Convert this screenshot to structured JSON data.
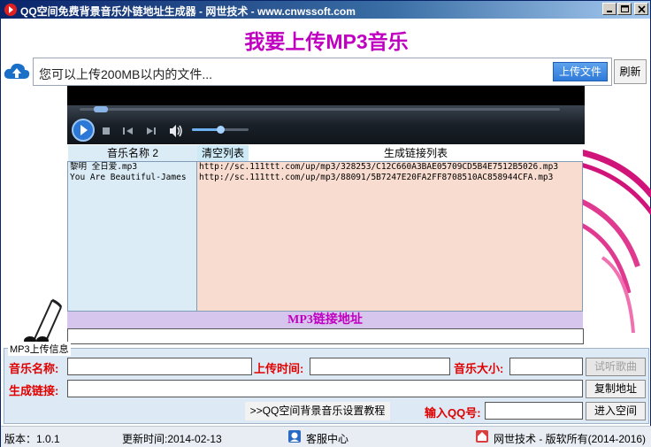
{
  "window": {
    "title": "QQ空间免费背景音乐外链地址生成器 - 网世技术 - www.cnwssoft.com",
    "minimize_label": "minimize",
    "maximize_label": "maximize",
    "close_label": "close"
  },
  "heading": "我要上传MP3音乐",
  "upload": {
    "placeholder": "您可以上传200MB以内的文件...",
    "upload_button": "上传文件",
    "refresh_button": "刷新"
  },
  "player": {
    "icons": [
      "play-icon",
      "stop-icon",
      "prev-icon",
      "next-icon",
      "volume-icon"
    ],
    "volume_level": 0.5
  },
  "list": {
    "names_header": "音乐名称 2",
    "clear_button": "清空列表",
    "links_header": "生成链接列表",
    "names": [
      "黎明  全日爱.mp3",
      "You Are Beautiful-James"
    ],
    "links": [
      "http://sc.111ttt.com/up/mp3/328253/C12C660A3BAE05709CD5B4E7512B5026.mp3",
      "http://sc.111ttt.com/up/mp3/88091/5B7247E20FA2FF8708510AC858944CFA.mp3"
    ]
  },
  "mp3_link": {
    "label": "MP3链接地址",
    "value": ""
  },
  "upload_info": {
    "group_label": "MP3上传信息",
    "name_label": "音乐名称:",
    "name_value": "",
    "time_label": "上传时间:",
    "time_value": "",
    "size_label": "音乐大小:",
    "size_value": "",
    "preview_button": "试听歌曲",
    "link_label": "生成链接:",
    "link_value": "",
    "copy_button": "复制地址",
    "tutorial_link": ">>QQ空间背景音乐设置教程",
    "qq_label": "输入QQ号:",
    "qq_value": "",
    "enter_button": "进入空间"
  },
  "status": {
    "version": "版本：1.0.1",
    "updated": "更新时间:2014-02-13",
    "support": "客服中心",
    "copyright": "网世技术 - 版软所有(2014-2016)"
  },
  "colors": {
    "heading": "#c000c0",
    "label_red": "#e00000",
    "titlebar": "#0a246a"
  }
}
